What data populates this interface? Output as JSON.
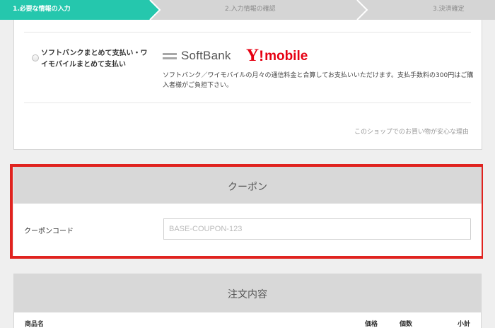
{
  "steps": [
    {
      "label": "1.必要な情報の入力",
      "state": "active"
    },
    {
      "label": "2.入力情報の確認",
      "state": "inactive"
    },
    {
      "label": "3.決済確定",
      "state": "inactive"
    }
  ],
  "colors": {
    "active_step": "#25c7ad",
    "inactive_step": "#d5d5d5",
    "highlight": "#e0231f",
    "ymobile_red": "#e60012"
  },
  "payment": {
    "option_label": "ソフトバンクまとめて支払い・ワイモバイルまとめて支払い",
    "softbank_logo": "SoftBank",
    "ymobile_logo_y": "Y",
    "ymobile_logo_bang": "!",
    "ymobile_logo_text": "mobile",
    "description": "ソフトバンク／ワイモバイルの月々の通信料金と合算してお支払いいただけます。支払手数料の300円はご購入者様がご負担下さい。",
    "safe_link": "このショップでのお買い物が安心な理由"
  },
  "coupon": {
    "title": "クーポン",
    "code_label": "クーポンコード",
    "placeholder": "BASE-COUPON-123"
  },
  "order": {
    "title": "注文内容",
    "columns": {
      "name": "商品名",
      "price": "価格",
      "qty": "個数",
      "subtotal": "小計"
    }
  }
}
